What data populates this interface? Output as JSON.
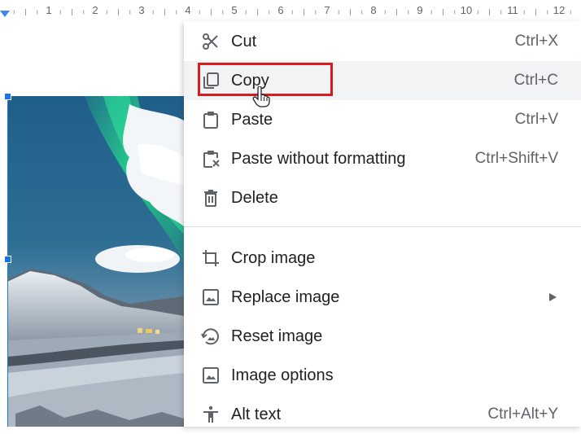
{
  "ruler": {
    "numbers": [
      "1",
      "2",
      "3",
      "4",
      "5",
      "6",
      "7",
      "8",
      "9",
      "10",
      "11",
      "12"
    ]
  },
  "menu": {
    "items": [
      {
        "label": "Cut",
        "shortcut": "Ctrl+X",
        "icon": "scissors-icon"
      },
      {
        "label": "Copy",
        "shortcut": "Ctrl+C",
        "icon": "copy-icon"
      },
      {
        "label": "Paste",
        "shortcut": "Ctrl+V",
        "icon": "paste-icon"
      },
      {
        "label": "Paste without formatting",
        "shortcut": "Ctrl+Shift+V",
        "icon": "paste-plain-icon"
      },
      {
        "label": "Delete",
        "shortcut": "",
        "icon": "trash-icon"
      },
      {
        "label": "Crop image",
        "shortcut": "",
        "icon": "crop-icon"
      },
      {
        "label": "Replace image",
        "shortcut": "",
        "icon": "image-icon"
      },
      {
        "label": "Reset image",
        "shortcut": "",
        "icon": "reset-image-icon"
      },
      {
        "label": "Image options",
        "shortcut": "",
        "icon": "image-options-icon"
      },
      {
        "label": "Alt text",
        "shortcut": "Ctrl+Alt+Y",
        "icon": "accessibility-icon"
      }
    ]
  },
  "colors": {
    "highlight": "#d81b1b",
    "hover": "#f1f3f4",
    "selection": "#1a73e8"
  }
}
